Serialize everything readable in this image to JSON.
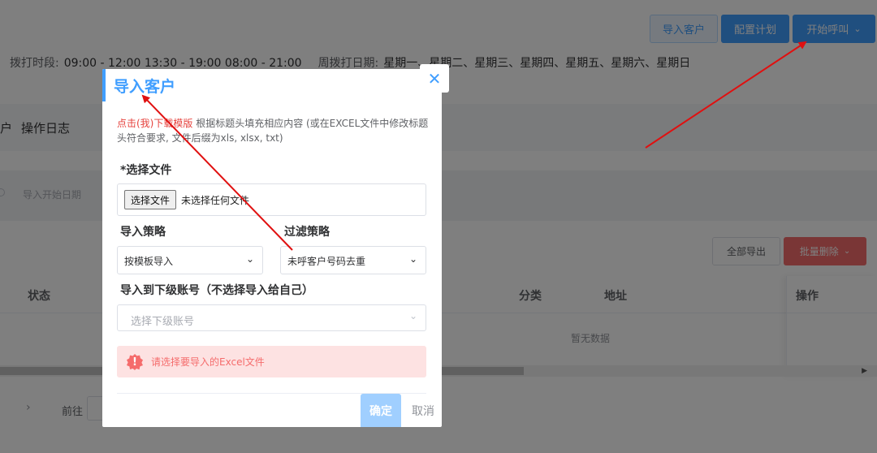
{
  "toolbar": {
    "import_label": "导入客户",
    "plan_label": "配置计划",
    "call_label": "开始呼叫"
  },
  "schedule": {
    "time_label": "拨打时段:",
    "time_value": "09:00 - 12:00 13:30 - 19:00 08:00 - 21:00",
    "week_label": "周拨打日期:",
    "week_value": "星期一、星期二、星期三、星期四、星期五、星期六、星期日"
  },
  "tabs": {
    "fragment": "户",
    "log": "操作日志"
  },
  "filters": {
    "date_placeholder": "导入开始日期"
  },
  "actions": {
    "export_all": "全部导出",
    "batch_delete": "批量删除"
  },
  "table": {
    "columns": [
      "状态",
      "分类",
      "地址",
      "操作"
    ],
    "empty_text": "暂无数据"
  },
  "pager": {
    "goto_label": "前往"
  },
  "dialog": {
    "title": "导入客户",
    "tip_link": "点击(我)下载模版",
    "tip_text": " 根据标题头填充相应内容 (或在EXCEL文件中修改标题头符合要求, 文件后缀为xls, xlsx, txt)",
    "file_label": "*选择文件",
    "file_button": "选择文件",
    "file_status": "未选择任何文件",
    "import_strategy_label": "导入策略",
    "import_strategy_value": "按模板导入",
    "filter_strategy_label": "过滤策略",
    "filter_strategy_value": "未呼客户号码去重",
    "sub_account_label": "导入到下级账号（不选择导入给自己）",
    "sub_account_placeholder": "选择下级账号",
    "alert_text": "请选择要导入的Excel文件",
    "ok_label": "确定",
    "cancel_label": "取消"
  },
  "colors": {
    "primary": "#409eff",
    "danger": "#f56c6c",
    "arrow": "#e01010"
  }
}
